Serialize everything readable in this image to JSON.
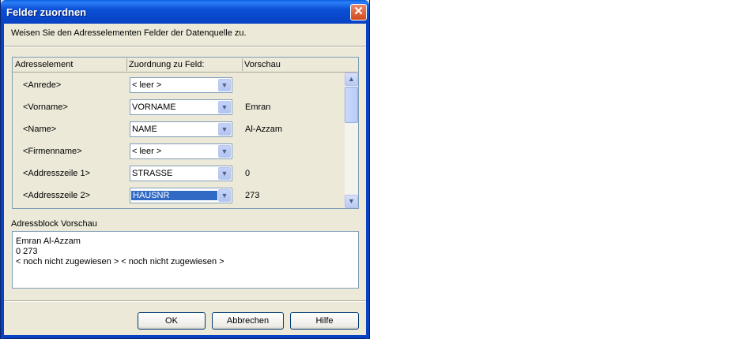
{
  "window": {
    "title": "Felder zuordnen",
    "close_glyph": "✕"
  },
  "instruction": "Weisen Sie den Adresselementen Felder der Datenquelle zu.",
  "table": {
    "headers": [
      "Adresselement",
      "Zuordnung zu Feld:",
      "Vorschau"
    ],
    "rows": [
      {
        "label": "<Anrede>",
        "field": "< leer >",
        "preview": ""
      },
      {
        "label": "<Vorname>",
        "field": "VORNAME",
        "preview": "Emran"
      },
      {
        "label": "<Name>",
        "field": "NAME",
        "preview": "Al-Azzam"
      },
      {
        "label": "<Firmenname>",
        "field": "< leer >",
        "preview": ""
      },
      {
        "label": "<Addresszeile 1>",
        "field": "STRASSE",
        "preview": "0"
      },
      {
        "label": "<Addresszeile 2>",
        "field": "HAUSNR",
        "preview": "273"
      }
    ]
  },
  "preview_section": {
    "label": "Adressblock Vorschau",
    "lines": [
      "Emran Al-Azzam",
      "0 273",
      "< noch nicht zugewiesen > < noch nicht zugewiesen >"
    ]
  },
  "buttons": {
    "ok": "OK",
    "cancel": "Abbrechen",
    "help": "Hilfe"
  },
  "icons": {
    "dropdown": "▼",
    "scroll_up": "▲",
    "scroll_down": "▼"
  },
  "colors": {
    "titlebar": "#0842c2",
    "selection": "#316ac5",
    "dialog_bg": "#ece9d8"
  }
}
